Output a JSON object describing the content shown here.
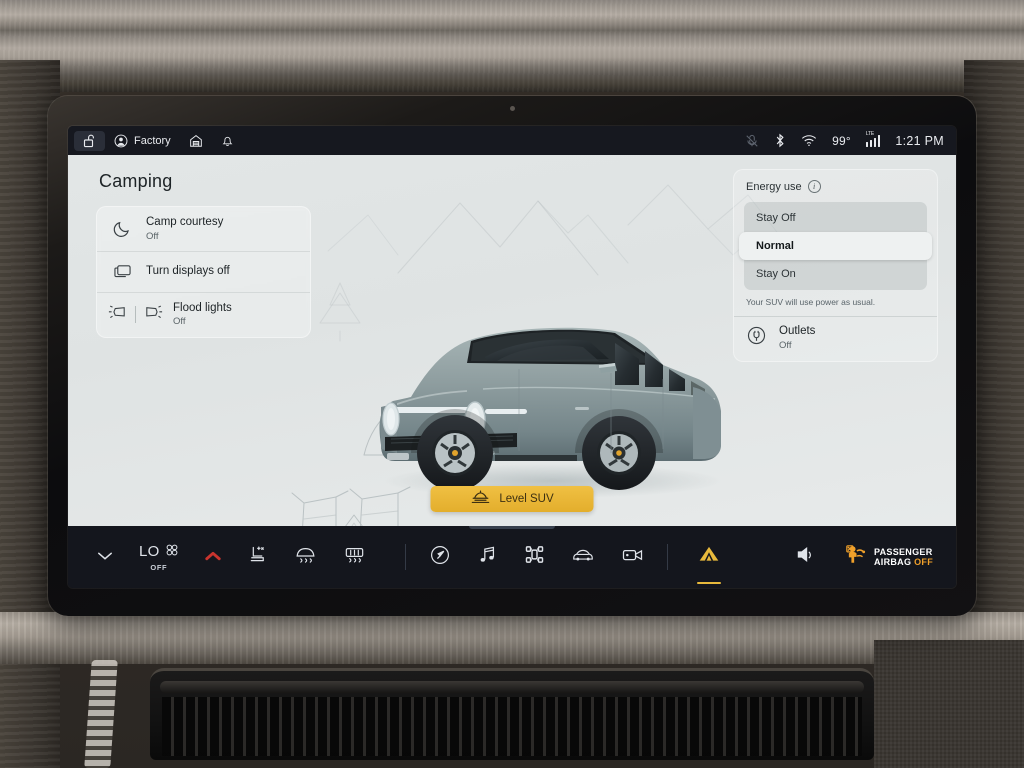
{
  "statusbar": {
    "lock": {
      "icon": "unlocked-padlock-icon",
      "label": ""
    },
    "profile": {
      "icon": "user-avatar-icon",
      "label": "Factory"
    },
    "garage": {
      "icon": "garage-home-icon"
    },
    "notifications": {
      "icon": "bell-icon"
    },
    "mute": {
      "icon": "microphone-muted-icon"
    },
    "bluetooth": {
      "icon": "bluetooth-icon"
    },
    "wifi": {
      "icon": "wifi-icon"
    },
    "temperature": "99°",
    "network_label": "LTE",
    "signal": {
      "icon": "signal-bars-icon",
      "bars": 4
    },
    "time": "1:21 PM"
  },
  "page": {
    "title": "Camping"
  },
  "left_panel": {
    "rows": [
      {
        "icon": "moon-icon",
        "label": "Camp courtesy",
        "sub": "Off"
      },
      {
        "icon": "displays-icon",
        "label": "Turn displays off",
        "sub": ""
      },
      {
        "icon_left": "flood-light-left-icon",
        "icon_right": "flood-light-right-icon",
        "label": "Flood lights",
        "sub": "Off"
      }
    ]
  },
  "right_panel": {
    "heading": "Energy use",
    "info_icon": "info-icon",
    "info_glyph": "i",
    "options": [
      {
        "label": "Stay Off",
        "selected": false
      },
      {
        "label": "Normal",
        "selected": true
      },
      {
        "label": "Stay On",
        "selected": false
      }
    ],
    "help_text": "Your SUV will use power as usual.",
    "outlets": {
      "icon": "power-plug-icon",
      "label": "Outlets",
      "sub": "Off"
    }
  },
  "hero": {
    "vehicle_name": "Rivian R1S",
    "body_color": "#8c9a9c",
    "roof_color": "#1b1f22",
    "glass_color": "#2b3033",
    "scene": "camping-sketch-illustration"
  },
  "level_button": {
    "label": "Level SUV",
    "icon": "vehicle-leveling-icon",
    "color": "#e9b934"
  },
  "taskbar": {
    "climate": {
      "down_icon": "chevron-down-icon",
      "temp": "LO",
      "fan_icon": "fan-icon",
      "fan_state": "OFF",
      "up_icon": "chevron-up-icon",
      "up_color": "#c9342e"
    },
    "climate_buttons": [
      {
        "icon": "seat-climate-icon",
        "name": "seat-climate"
      },
      {
        "icon": "front-defrost-icon",
        "name": "front-defrost"
      },
      {
        "icon": "rear-defrost-icon",
        "name": "rear-defrost"
      }
    ],
    "apps": [
      {
        "icon": "navigation-icon",
        "name": "navigation",
        "active": false
      },
      {
        "icon": "music-note-icon",
        "name": "music",
        "active": false
      },
      {
        "icon": "drive-modes-icon",
        "name": "drive-modes",
        "active": false
      },
      {
        "icon": "vehicle-icon",
        "name": "vehicle",
        "active": false
      },
      {
        "icon": "camera-icon",
        "name": "camera",
        "active": false
      },
      {
        "icon": "camp-mode-icon",
        "name": "camp-mode",
        "active": true
      }
    ],
    "volume": {
      "icon": "speaker-volume-icon"
    },
    "airbag": {
      "icon": "passenger-airbag-icon",
      "line1": "PASSENGER",
      "line2": "AIRBAG",
      "state": "OFF"
    }
  },
  "colors": {
    "screen_bg": "#e3e7e7",
    "taskbar_bg": "#14161d",
    "statusbar_bg": "#16181f",
    "accent_yellow": "#e9b934",
    "warning_orange": "#f0a02a",
    "heat_red": "#c9342e"
  }
}
